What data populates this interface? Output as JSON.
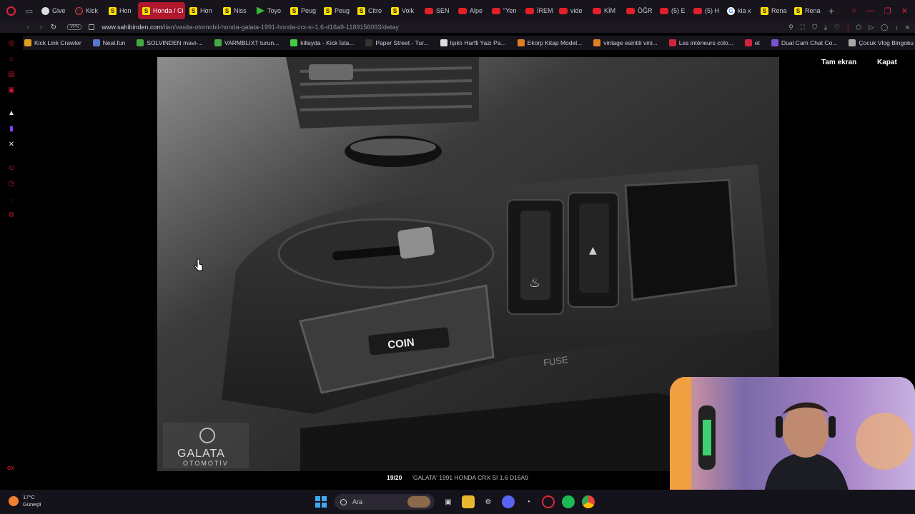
{
  "browser": {
    "tabs": [
      {
        "label": "Give",
        "icon": "github-icon",
        "active": false
      },
      {
        "label": "Kick",
        "icon": "kick-icon",
        "active": false
      },
      {
        "label": "Hon",
        "icon": "sahibinden-icon",
        "active": false
      },
      {
        "label": "Honda / Ci",
        "icon": "sahibinden-icon",
        "active": true
      },
      {
        "label": "Hon",
        "icon": "sahibinden-icon",
        "active": false
      },
      {
        "label": "Niss",
        "icon": "sahibinden-icon",
        "active": false
      },
      {
        "label": "Toyo",
        "icon": "toyota-icon",
        "active": false
      },
      {
        "label": "Peug",
        "icon": "sahibinden-icon",
        "active": false
      },
      {
        "label": "Peug",
        "icon": "sahibinden-icon",
        "active": false
      },
      {
        "label": "Citro",
        "icon": "sahibinden-icon",
        "active": false
      },
      {
        "label": "Volk",
        "icon": "sahibinden-icon",
        "active": false
      },
      {
        "label": "SEN",
        "icon": "youtube-icon",
        "active": false
      },
      {
        "label": "Alpe",
        "icon": "youtube-icon",
        "active": false
      },
      {
        "label": "\"Yen",
        "icon": "youtube-icon",
        "active": false
      },
      {
        "label": "İREM",
        "icon": "youtube-icon",
        "active": false
      },
      {
        "label": "vide",
        "icon": "youtube-icon",
        "active": false
      },
      {
        "label": "KİM",
        "icon": "youtube-icon",
        "active": false
      },
      {
        "label": "ÖĞR",
        "icon": "youtube-icon",
        "active": false
      },
      {
        "label": "(5) E",
        "icon": "youtube-icon",
        "active": false
      },
      {
        "label": "(5) H",
        "icon": "youtube-icon",
        "active": false
      },
      {
        "label": "kia x",
        "icon": "google-icon",
        "active": false
      },
      {
        "label": "Rena",
        "icon": "sahibinden-icon",
        "active": false
      },
      {
        "label": "Rena",
        "icon": "sahibinden-icon",
        "active": false
      }
    ],
    "new_tab": "+",
    "vpn_label": "VPN",
    "url_domain": "www.sahibinden.com",
    "url_path": "/ilan/vasita-otomobil-honda-galata-1991-honda-crx-si-1.6-d16a9-1189156093/detay",
    "accent_color": "#b0182d"
  },
  "bookmarks": [
    {
      "label": "Kick Link Crawler",
      "color": "#e0a020"
    },
    {
      "label": "Neal.fun",
      "color": "#5577cc"
    },
    {
      "label": "SOLVINDEN mavi-...",
      "color": "#44aa44"
    },
    {
      "label": "VARMBLIXT turun...",
      "color": "#44aa44"
    },
    {
      "label": "killayda - Kick İsta...",
      "color": "#44cc44"
    },
    {
      "label": "Paper Street - Tur...",
      "color": "#333333"
    },
    {
      "label": "Işıklı Harfli Yazı Pa...",
      "color": "#dddddd"
    },
    {
      "label": "Ekorp Kitap Model...",
      "color": "#e08020"
    },
    {
      "label": "vintage esintili vini...",
      "color": "#e08020"
    },
    {
      "label": "Les intérieurs colo...",
      "color": "#d0243a"
    },
    {
      "label": "et",
      "color": "#d0243a"
    },
    {
      "label": "Dual Cam Chat Co...",
      "color": "#7755cc"
    },
    {
      "label": "Çocuk Vlog Bingosu",
      "color": "#aaaaaa"
    }
  ],
  "viewer": {
    "fullscreen_label": "Tam ekran",
    "close_label": "Kapat",
    "counter": "19/20",
    "caption": "'GALATA' 1991 HONDA CRX Sİ 1.6 D16A9",
    "photo_labels": {
      "coin": "COIN",
      "brand_top": "GALATA",
      "brand_bottom": "OTOMOTİV",
      "fuse": "FUSE"
    }
  },
  "taskbar": {
    "temperature": "17°C",
    "weather_text": "Güneşli",
    "search_placeholder": "Ara"
  }
}
